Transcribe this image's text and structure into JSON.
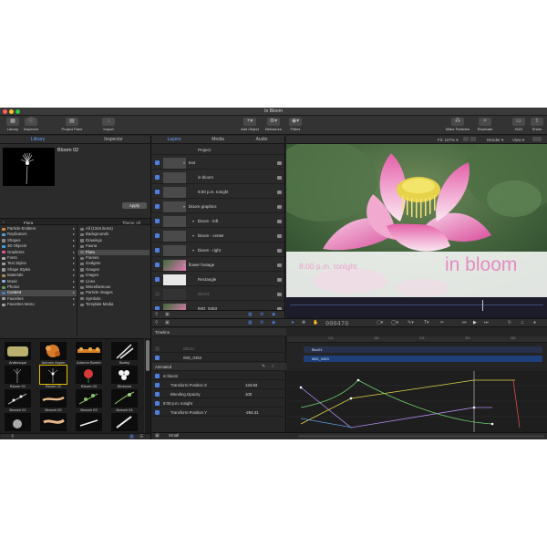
{
  "window": {
    "title": "In Bloom"
  },
  "toolbar": {
    "library": "Library",
    "inspector": "Inspector",
    "project_pane": "Project Pane",
    "import": "Import",
    "add_object": "Add Object",
    "behaviors": "Behaviors",
    "filters": "Filters",
    "make_particles": "Make Particles",
    "replicate": "Replicate",
    "hud": "HUD",
    "share": "Share"
  },
  "left_panel": {
    "tabs": [
      "Library",
      "Inspector"
    ],
    "preview_title": "Bloom 02",
    "apply_label": "Apply",
    "path": "Flora",
    "theme": "Theme: All",
    "categories": [
      {
        "label": "Particle Emitters",
        "color": "#d88a3a"
      },
      {
        "label": "Replicators",
        "color": "#5aa0d8"
      },
      {
        "label": "Shapes",
        "color": "#8a8a8a"
      },
      {
        "label": "3D Objects",
        "color": "#4aa0e0"
      },
      {
        "label": "Gradients",
        "color": "#e05a9a"
      },
      {
        "label": "Fonts",
        "color": "#b0b0b0"
      },
      {
        "label": "Text Styles",
        "color": "#a0a0a0"
      },
      {
        "label": "Shape Styles",
        "color": "#9a9a9a"
      },
      {
        "label": "Materials",
        "color": "#b08a5a"
      },
      {
        "label": "Music",
        "color": "#8ab0e0"
      },
      {
        "label": "Photos",
        "color": "#6a9a6a"
      },
      {
        "label": "Content",
        "color": "#4a7ac0"
      },
      {
        "label": "Favorites",
        "color": "#a0a0a0"
      },
      {
        "label": "Favorites Menu",
        "color": "#a0a0a0"
      }
    ],
    "selected_category": 11,
    "subcategories": [
      {
        "label": "All (1345 items)"
      },
      {
        "label": "Backgrounds"
      },
      {
        "label": "Drawings"
      },
      {
        "label": "Fauna"
      },
      {
        "label": "Flora"
      },
      {
        "label": "Frames"
      },
      {
        "label": "Gadgets"
      },
      {
        "label": "Gauges"
      },
      {
        "label": "Images"
      },
      {
        "label": "Lines"
      },
      {
        "label": "Miscellaneous"
      },
      {
        "label": "Particle Images"
      },
      {
        "label": "Symbols"
      },
      {
        "label": "Template Media"
      }
    ],
    "selected_subcategory": 4,
    "items": [
      {
        "label": "Arabesque",
        "kind": "arabesque"
      },
      {
        "label": "Autumn Aspen",
        "kind": "aspen"
      },
      {
        "label": "Autumn Border",
        "kind": "border"
      },
      {
        "label": "Barley",
        "kind": "barley"
      },
      {
        "label": "Bloom 01",
        "kind": "bloom1"
      },
      {
        "label": "Bloom 02",
        "kind": "bloom2"
      },
      {
        "label": "Bloom 03",
        "kind": "bloom3"
      },
      {
        "label": "Blossom",
        "kind": "blossom"
      },
      {
        "label": "Branch 01",
        "kind": "branch1"
      },
      {
        "label": "Branch 02",
        "kind": "branch2"
      },
      {
        "label": "Branch 03",
        "kind": "branch3"
      },
      {
        "label": "Branch 04",
        "kind": "branch4"
      },
      {
        "label": "",
        "kind": "p1"
      },
      {
        "label": "",
        "kind": "p2"
      },
      {
        "label": "",
        "kind": "p3"
      },
      {
        "label": "",
        "kind": "p4"
      }
    ],
    "selected_item": 5
  },
  "layers_panel": {
    "tabs": [
      "Layers",
      "Media",
      "Audio"
    ],
    "rows": [
      {
        "name": "Project",
        "indent": 0,
        "thumb": false,
        "check": false,
        "small": true
      },
      {
        "name": "text",
        "indent": 0,
        "thumb": true,
        "check": true,
        "group": true
      },
      {
        "name": "in bloom",
        "indent": 1,
        "thumb": true,
        "check": true
      },
      {
        "name": "8:00 p.m. tonight",
        "indent": 1,
        "thumb": true,
        "check": true
      },
      {
        "name": "bloom graphics",
        "indent": 0,
        "thumb": true,
        "check": true,
        "group": true
      },
      {
        "name": "bloom - left",
        "indent": 1,
        "thumb": true,
        "check": true,
        "group": true
      },
      {
        "name": "bloom - center",
        "indent": 1,
        "thumb": true,
        "check": true,
        "group": true
      },
      {
        "name": "bloom - right",
        "indent": 1,
        "thumb": true,
        "check": true,
        "group": true
      },
      {
        "name": "flower footage",
        "indent": 0,
        "thumb": true,
        "check": true,
        "group": true,
        "pink": true
      },
      {
        "name": "Rectangle",
        "indent": 1,
        "thumb": true,
        "check": true,
        "white": true
      },
      {
        "name": "Blur01",
        "indent": 1,
        "thumb": true,
        "check": false,
        "dim": true
      },
      {
        "name": "IMG_0453",
        "indent": 1,
        "thumb": true,
        "check": true,
        "pink": true
      }
    ]
  },
  "canvas": {
    "fit": "Fit: 107% ▾",
    "render": "Render ▾",
    "view": "View ▾",
    "overlay_small": "8:00 p.m. tonight",
    "overlay_big": "in bloom"
  },
  "transport": {
    "timecode": "000470"
  },
  "timeline": {
    "title": "Timeline",
    "animated_label": "Animated",
    "rows": [
      {
        "name": "Blur01",
        "value": "",
        "dim": true
      },
      {
        "name": "IMG_0453",
        "value": "",
        "dim": false
      }
    ],
    "params": [
      {
        "name": "in bloom",
        "value": "",
        "indent": 0,
        "group": true
      },
      {
        "name": "Transform.Position.X",
        "value": "134.83",
        "indent": 1
      },
      {
        "name": "Blending.Opacity",
        "value": "100",
        "indent": 1
      },
      {
        "name": "8:00 p.m. tonight",
        "value": "",
        "indent": 0,
        "group": true
      },
      {
        "name": "Transform.Position.Y",
        "value": "-264.31",
        "indent": 1
      }
    ],
    "ruler_ticks": [
      "121",
      "181",
      "241",
      "301",
      "361",
      "421"
    ],
    "bars": [
      {
        "name": "Blur01",
        "color": "#26304a"
      },
      {
        "name": "IMG_0453",
        "color": "#1e3f7a"
      }
    ],
    "footer_label": "Small"
  },
  "colors": {
    "accent": "#6aa0ff",
    "selection": "#e3c000",
    "pink_text": "#e889c4"
  }
}
